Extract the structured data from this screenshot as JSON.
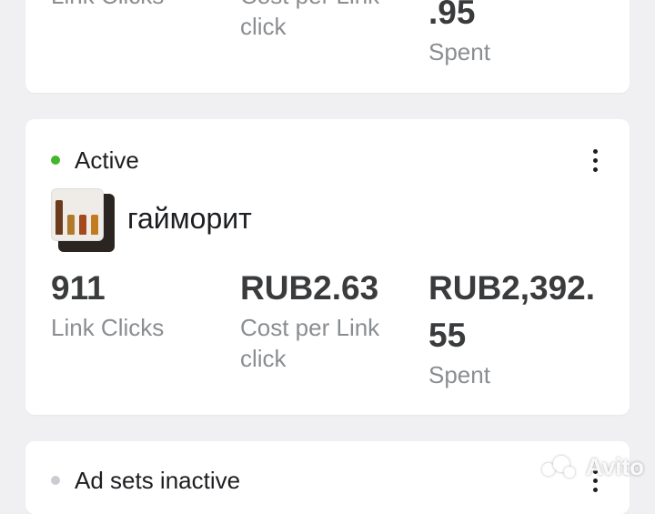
{
  "cards": {
    "previous": {
      "link_clicks_label": "Link Clicks",
      "cpc_label_line1": "Cost per Link",
      "cpc_label_line2": "click",
      "spent_value_tail": ".95",
      "spent_label": "Spent"
    },
    "active": {
      "status": "Active",
      "status_color": "#42b72a",
      "campaign_name": "гайморит",
      "link_clicks_value": "911",
      "link_clicks_label": "Link Clicks",
      "cpc_value": "RUB2.63",
      "cpc_label_line1": "Cost per Link",
      "cpc_label_line2": "click",
      "spent_value_line1": "RUB2,392.",
      "spent_value_line2": "55",
      "spent_label": "Spent"
    },
    "next": {
      "status": "Ad sets inactive",
      "status_color": "#c9ccd1"
    }
  },
  "icons": {
    "menu": "more-vertical-icon"
  },
  "watermark": {
    "text": "Avito"
  }
}
